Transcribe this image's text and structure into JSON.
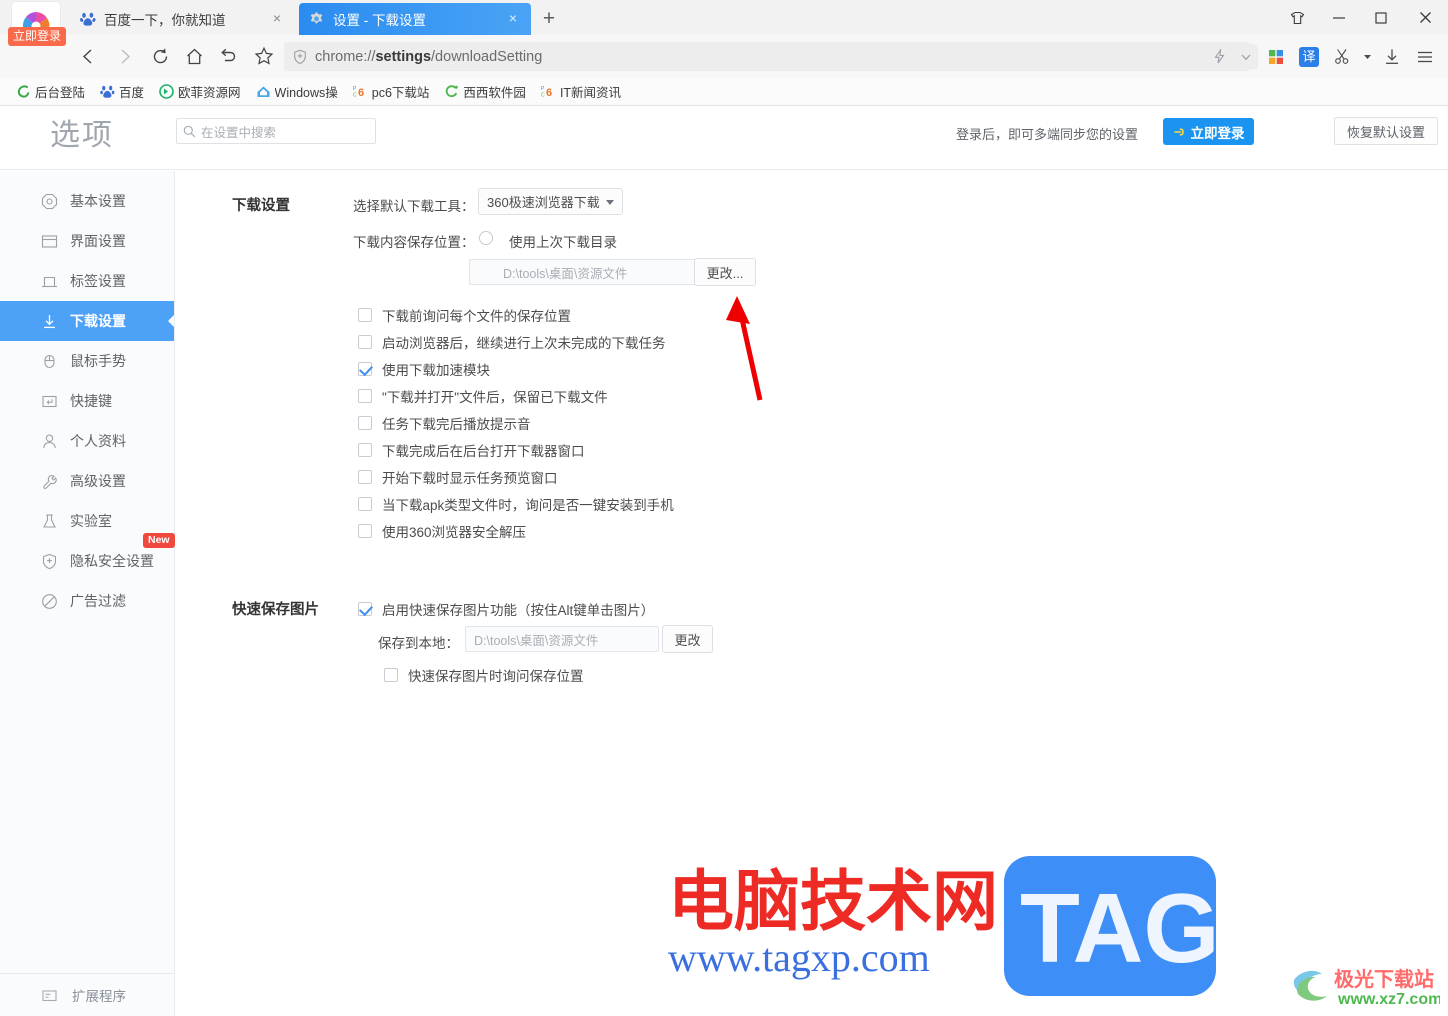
{
  "window": {
    "controls": [
      {
        "name": "skin",
        "glyph": "skin-icon"
      },
      {
        "name": "minimize",
        "glyph": "minimize-icon"
      },
      {
        "name": "maximize",
        "glyph": "maximize-icon"
      },
      {
        "name": "close",
        "glyph": "close-icon"
      }
    ]
  },
  "tabs": [
    {
      "title": "百度一下，你就知道",
      "favicon": "baidu-icon",
      "active": false,
      "close": "×"
    },
    {
      "title": "设置 - 下载设置",
      "favicon": "gear-icon",
      "active": true,
      "close": "×"
    }
  ],
  "newtab_label": "+",
  "login_badge": "立即登录",
  "omnibox": {
    "url_prefix": "chrome://",
    "url_bold": "settings",
    "url_suffix": "/downloadSetting",
    "full_url": "chrome://settings/downloadSetting"
  },
  "toolbar_right": [
    {
      "name": "speed-boost-icon",
      "label": ""
    },
    {
      "name": "chevron-down-icon",
      "label": ""
    },
    {
      "name": "windows-apps-icon",
      "label": ""
    },
    {
      "name": "translate-icon",
      "label": "译"
    },
    {
      "name": "scissors-icon",
      "label": ""
    },
    {
      "name": "scissors-dropdown-caret",
      "label": ""
    },
    {
      "name": "download-icon",
      "label": ""
    },
    {
      "name": "menu-icon",
      "label": ""
    }
  ],
  "bookmarks": [
    {
      "label": "后台登陆",
      "icon": "swirl-green-icon"
    },
    {
      "label": "百度",
      "icon": "baidu-icon"
    },
    {
      "label": "欧菲资源网",
      "icon": "green-circle-icon"
    },
    {
      "label": "Windows操",
      "icon": "windows-house-icon"
    },
    {
      "label": "pc6下载站",
      "icon": "pc6-icon"
    },
    {
      "label": "西西软件园",
      "icon": "cc-green-icon"
    },
    {
      "label": "IT新闻资讯",
      "icon": "pc6-icon"
    }
  ],
  "settings_header": {
    "title": "选项",
    "search_placeholder": "在设置中搜索",
    "sync_text": "登录后，即可多端同步您的设置",
    "login_button": "立即登录",
    "reset_button": "恢复默认设置"
  },
  "sidebar": {
    "items": [
      {
        "label": "基本设置",
        "icon": "octagon-icon",
        "active": false,
        "badge": null
      },
      {
        "label": "界面设置",
        "icon": "window-icon",
        "active": false,
        "badge": null
      },
      {
        "label": "标签设置",
        "icon": "tab-icon",
        "active": false,
        "badge": null
      },
      {
        "label": "下载设置",
        "icon": "download-arrow-icon",
        "active": true,
        "badge": null
      },
      {
        "label": "鼠标手势",
        "icon": "mouse-icon",
        "active": false,
        "badge": null
      },
      {
        "label": "快捷键",
        "icon": "keyboard-key-icon",
        "active": false,
        "badge": null
      },
      {
        "label": "个人资料",
        "icon": "person-icon",
        "active": false,
        "badge": null
      },
      {
        "label": "高级设置",
        "icon": "wrench-icon",
        "active": false,
        "badge": null
      },
      {
        "label": "实验室",
        "icon": "flask-icon",
        "active": false,
        "badge": null
      },
      {
        "label": "隐私安全设置",
        "icon": "shield-plus-icon",
        "active": false,
        "badge": "New"
      },
      {
        "label": "广告过滤",
        "icon": "no-entry-icon",
        "active": false,
        "badge": null
      }
    ],
    "bottom_item": {
      "label": "扩展程序",
      "icon": "extension-icon"
    }
  },
  "main": {
    "section_download": {
      "title": "下载设置",
      "default_tool_label": "选择默认下载工具：",
      "default_tool_value": "360极速浏览器下载",
      "save_location_label": "下载内容保存位置：",
      "radio_last_dir": {
        "label": "使用上次下载目录",
        "checked": false
      },
      "radio_custom_dir": {
        "checked": true,
        "path": "D:\\tools\\桌面\\资源文件",
        "change_button": "更改..."
      },
      "checkboxes": [
        {
          "label": "下载前询问每个文件的保存位置",
          "checked": false
        },
        {
          "label": "启动浏览器后，继续进行上次未完成的下载任务",
          "checked": false
        },
        {
          "label": "使用下载加速模块",
          "checked": true
        },
        {
          "label": "\"下载并打开\"文件后，保留已下载文件",
          "checked": false
        },
        {
          "label": "任务下载完后播放提示音",
          "checked": false
        },
        {
          "label": "下载完成后在后台打开下载器窗口",
          "checked": false
        },
        {
          "label": "开始下载时显示任务预览窗口",
          "checked": false
        },
        {
          "label": "当下载apk类型文件时，询问是否一键安装到手机",
          "checked": false
        },
        {
          "label": "使用360浏览器安全解压",
          "checked": false
        }
      ]
    },
    "section_quicksave": {
      "title": "快速保存图片",
      "enable_checkbox": {
        "label": "启用快速保存图片功能（按住Alt键单击图片）",
        "checked": true
      },
      "save_local_label": "保存到本地：",
      "save_local_path": "D:\\tools\\桌面\\资源文件",
      "change_button": "更改",
      "ask_checkbox": {
        "label": "快速保存图片时询问保存位置",
        "checked": false
      }
    }
  },
  "watermarks": {
    "main_cn": "电脑技术网",
    "main_url": "www.tagxp.com",
    "main_tag": "TAG",
    "corner_cn": "极光下载站",
    "corner_url": "www.xz7.com"
  },
  "colors": {
    "accent_blue": "#1a94f0",
    "active_tab_blue": "#2a8cf0",
    "sidebar_active": "#4da2f7",
    "badge_red": "#f0483c",
    "login_orange": "#f96a4a",
    "arrow_red": "#ee0000"
  }
}
